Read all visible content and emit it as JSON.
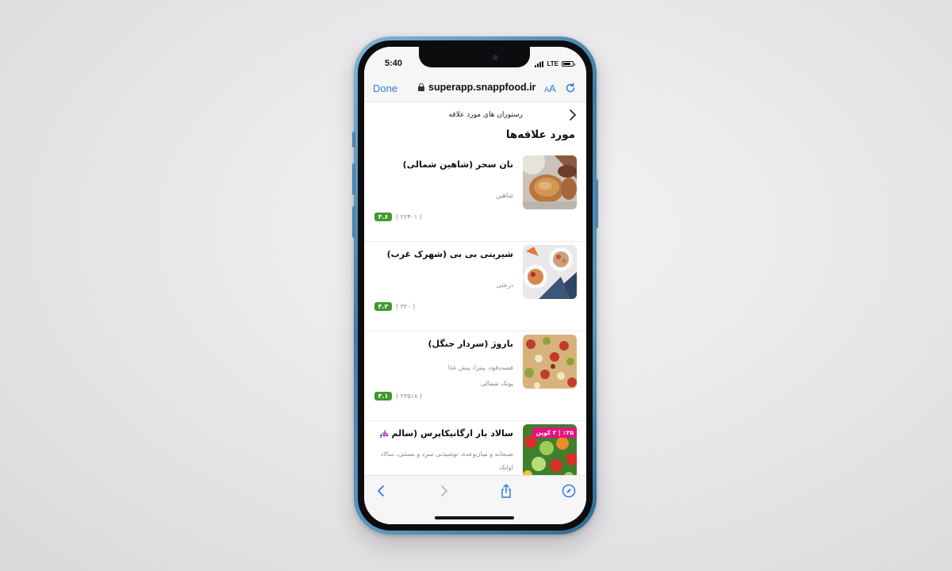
{
  "status_bar": {
    "time": "5:40",
    "network": "LTE",
    "battery_level": 0.8
  },
  "browser": {
    "done_label": "Done",
    "url": "superapp.snappfood.ir",
    "text_size_label": "AA"
  },
  "page": {
    "crumb": "رستوران های مورد علاقه",
    "section_title": "مورد علاقه‌ها",
    "restaurants": [
      {
        "name": "نان سحر (شاهین شمالی)",
        "category": "",
        "area": "شاهین",
        "rating": "۴.۶",
        "reviews": "( ۲۲۴۰۱ )"
      },
      {
        "name": "شیرینی بی بی (شهرک غرب)",
        "category": "",
        "area": "درختی",
        "rating": "۴.۳",
        "reviews": "( ۳۲۰ )"
      },
      {
        "name": "باروژ (سردار جنگل)",
        "category": "فست‌فود، پیتزا، پیش غذا",
        "area": "پونک شمالی",
        "rating": "۴.۱",
        "reviews": "( ۲۳۵۱۸ )"
      },
      {
        "name": "سالاد بار ارگانیکاپرس (سالم و...",
        "category": "صبحانه و میان‌وعده، نوشیدنی سرد و بستنی، سالاد",
        "area": "اوانک",
        "coupon": "٪۲۵ | ۲ کوپن"
      }
    ]
  },
  "colors": {
    "link_blue": "#2f7bd9",
    "rating_green": "#3f9a2d",
    "coupon_pink": "#e5137e",
    "phone_frame": "#3f7ea8"
  },
  "icons": [
    "lock-icon",
    "text-size-icon",
    "reload-icon",
    "chevron-right-icon",
    "sparkle-icon",
    "back-icon",
    "forward-icon",
    "share-icon",
    "compass-icon"
  ]
}
